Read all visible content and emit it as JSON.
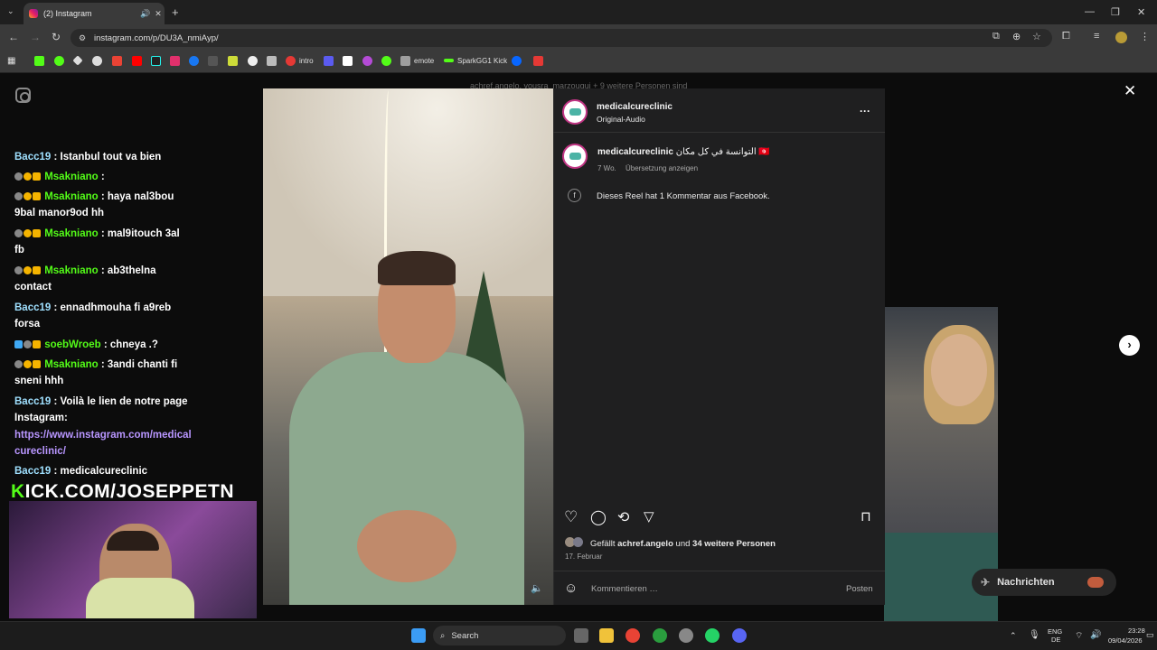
{
  "browser": {
    "tab_title": "(2) Instagram",
    "url": "instagram.com/p/DU3A_nmiAyp/",
    "bookmarks": [
      {
        "label": "intro",
        "color": "#e53935"
      },
      {
        "label": "emote",
        "color": "#9e9e9e"
      },
      {
        "label": "SparkGG1 Kick",
        "color": "#53fc18"
      }
    ]
  },
  "chat": {
    "messages": [
      {
        "user": "Bacc19",
        "text": ": Istanbul tout va bien"
      },
      {
        "user": "Msakniano",
        "text": ":"
      },
      {
        "user": "Msakniano",
        "text": ": haya nal3bou",
        "cont": "9bal manor9od hh"
      },
      {
        "user": "Msakniano",
        "text": ": mal9itouch 3al",
        "cont": "fb"
      },
      {
        "user": "Msakniano",
        "text": ": ab3thelna",
        "cont": "contact"
      },
      {
        "user": "Bacc19",
        "text": ": ennadhmouha fi a9reb",
        "cont": "forsa"
      },
      {
        "user": "soebWroeb",
        "text": ": chneya .?"
      },
      {
        "user": "Msakniano",
        "text": ": 3andi chanti fi",
        "cont": "sneni hhh"
      },
      {
        "user": "Bacc19",
        "text": ": Voilà le lien de notre page",
        "cont": "Instagram:"
      },
      {
        "user": "Bacc19",
        "text": ": medicalcureclinic"
      }
    ],
    "link_line1": "https://www.instagram.com/medical",
    "link_line2": "cureclinic/",
    "kick_banner_k": "K",
    "kick_banner_rest": "ICK.COM/JOSEPPETN"
  },
  "post": {
    "author": "medicalcureclinic",
    "audio": "Original-Audio",
    "caption_author": "medicalcureclinic",
    "caption_text": "التوانسة في كل مكان 🇹🇳",
    "age": "7 Wo.",
    "translate": "Übersetzung anzeigen",
    "fb_comment_note": "Dieses Reel hat 1 Kommentar aus Facebook.",
    "likes_prefix": "Gefällt",
    "likes_user": "achref.angelo",
    "likes_and": "und",
    "likes_others": "34 weitere Personen",
    "date": "17. Februar",
    "comment_placeholder": "Kommentieren …",
    "post_button": "Posten",
    "more": "···"
  },
  "page": {
    "messages_button": "Nachrichten",
    "top_note": "achref.angelo, yousra_marzougui + 9 weitere Personen sind"
  },
  "taskbar": {
    "search": "Search",
    "lang1": "ENG",
    "lang2": "DE",
    "time": "23:28",
    "date": "09/04/2026"
  }
}
